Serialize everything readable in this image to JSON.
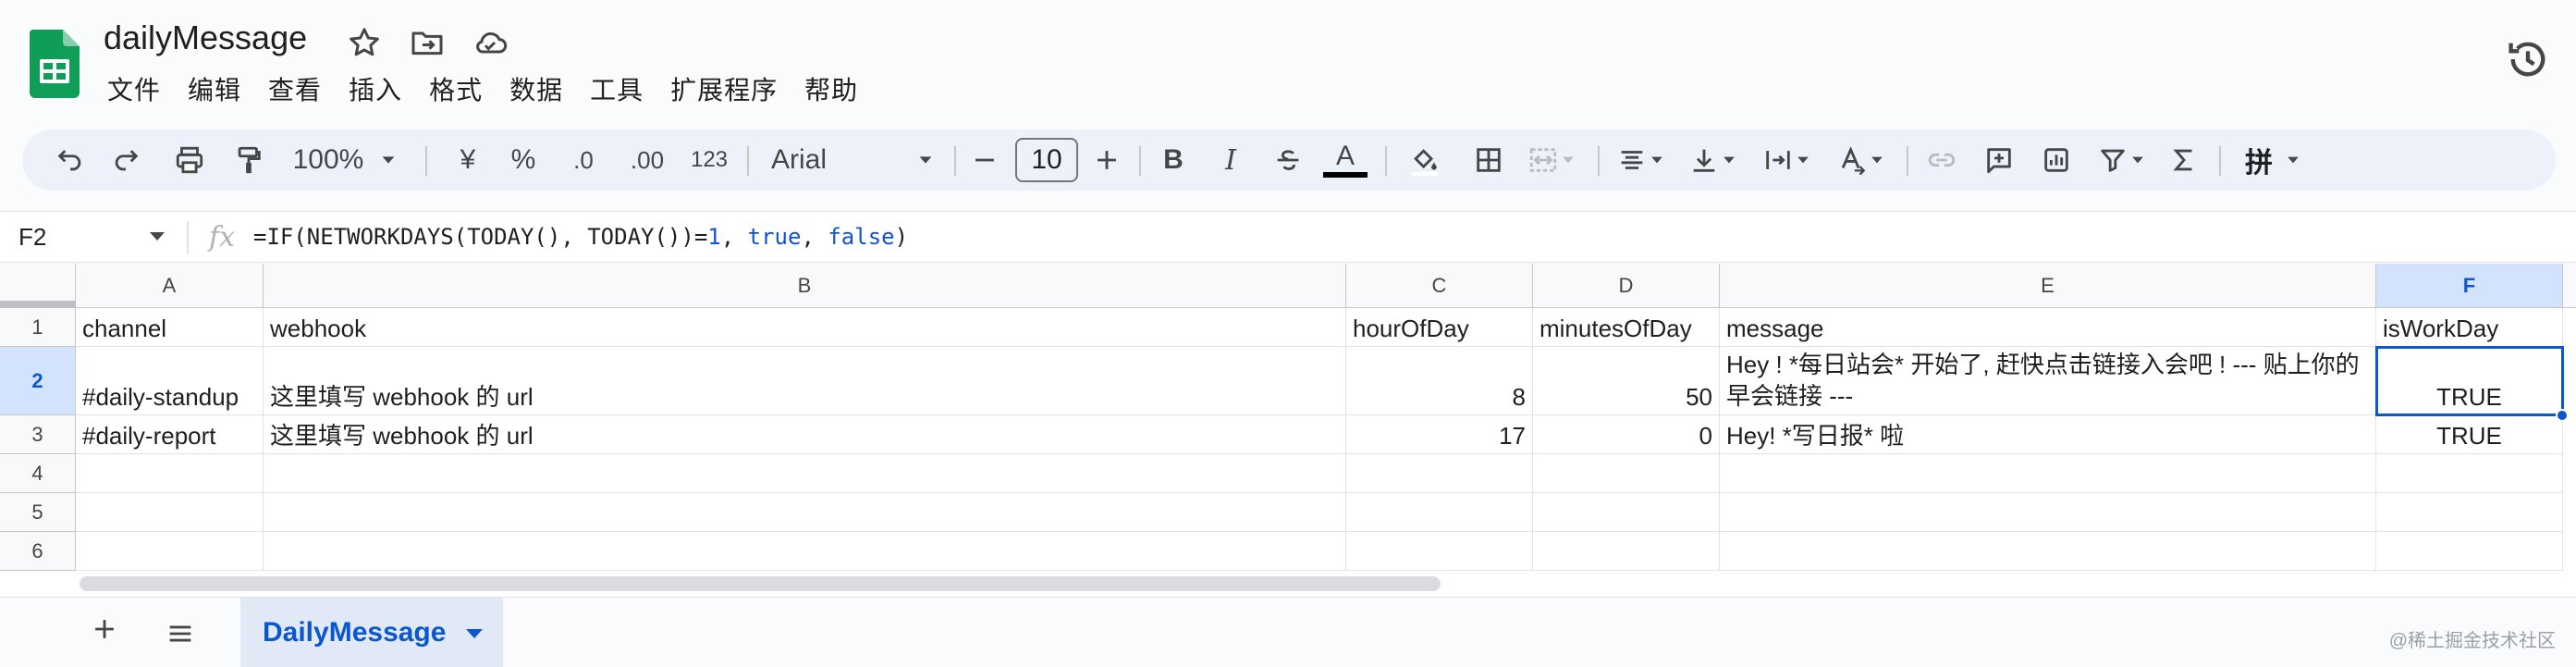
{
  "app": {
    "doc_title": "dailyMessage",
    "icons": [
      "star-icon",
      "move-folder-icon",
      "cloud-status-icon",
      "version-history-icon"
    ]
  },
  "menu": [
    "文件",
    "编辑",
    "查看",
    "插入",
    "格式",
    "数据",
    "工具",
    "扩展程序",
    "帮助"
  ],
  "toolbar": {
    "zoom": "100%",
    "currency": "¥",
    "percent": "%",
    "decrease_decimal": ".0",
    "increase_decimal": ".00",
    "number_format": "123",
    "font": "Arial",
    "font_size": "10",
    "bold": "B",
    "italic": "I",
    "text_color": "A",
    "input_tool": "拼"
  },
  "formula_bar": {
    "cell_ref": "F2",
    "fx": "fx",
    "formula_prefix": "=IF(NETWORKDAYS(TODAY(), TODAY())=",
    "formula_num": "1",
    "formula_sep1": ", ",
    "formula_true": "true",
    "formula_sep2": ", ",
    "formula_false": "false",
    "formula_suffix": ")"
  },
  "grid": {
    "columns": [
      "A",
      "B",
      "C",
      "D",
      "E",
      "F"
    ],
    "selected_column": "F",
    "rows": [
      "1",
      "2",
      "3",
      "4",
      "5",
      "6"
    ],
    "selected_row": "2",
    "cells": {
      "r1": [
        "channel",
        "webhook",
        "hourOfDay",
        "minutesOfDay",
        "message",
        "isWorkDay"
      ],
      "r2": [
        "#daily-standup",
        "这里填写 webhook 的 url",
        "8",
        "50",
        " Hey ! *每日站会*  开始了, 赶快点击链接入会吧 ! --- 贴上你的早会链接  ---",
        "TRUE"
      ],
      "r3": [
        "#daily-report",
        "这里填写 webhook 的 url",
        "17",
        "0",
        " Hey!  *写日报* 啦",
        "TRUE"
      ]
    },
    "selected_cell": "F2"
  },
  "sheets": {
    "active": "DailyMessage"
  },
  "watermark": "@稀土掘金技术社区",
  "colors": {
    "accent": "#0b57d0",
    "sheets_green": "#0f9d58",
    "selection_fill": "#d3e3fd"
  }
}
